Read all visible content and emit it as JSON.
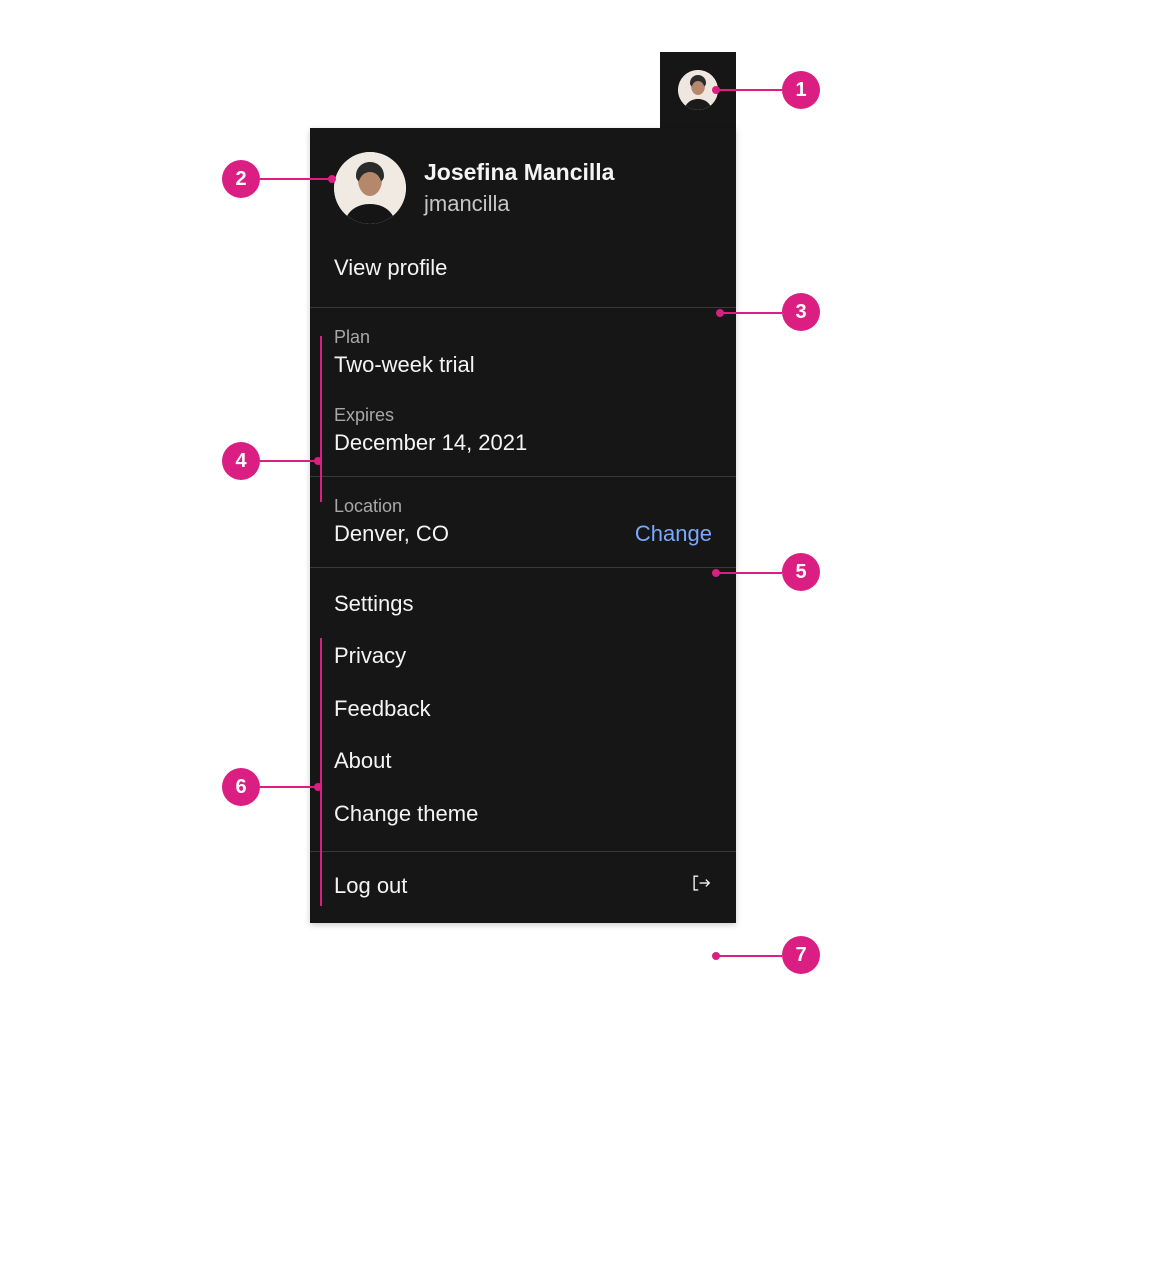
{
  "profile": {
    "display_name": "Josefina Mancilla",
    "username": "jmancilla",
    "view_profile_label": "View profile"
  },
  "plan": {
    "label": "Plan",
    "value": "Two-week trial"
  },
  "expires": {
    "label": "Expires",
    "value": "December 14, 2021"
  },
  "location": {
    "label": "Location",
    "value": "Denver, CO",
    "change_label": "Change"
  },
  "menu": {
    "items": [
      {
        "label": "Settings"
      },
      {
        "label": "Privacy"
      },
      {
        "label": "Feedback"
      },
      {
        "label": "About"
      },
      {
        "label": "Change theme"
      }
    ]
  },
  "logout": {
    "label": "Log out"
  },
  "annotations": {
    "n1": "1",
    "n2": "2",
    "n3": "3",
    "n4": "4",
    "n5": "5",
    "n6": "6",
    "n7": "7"
  }
}
